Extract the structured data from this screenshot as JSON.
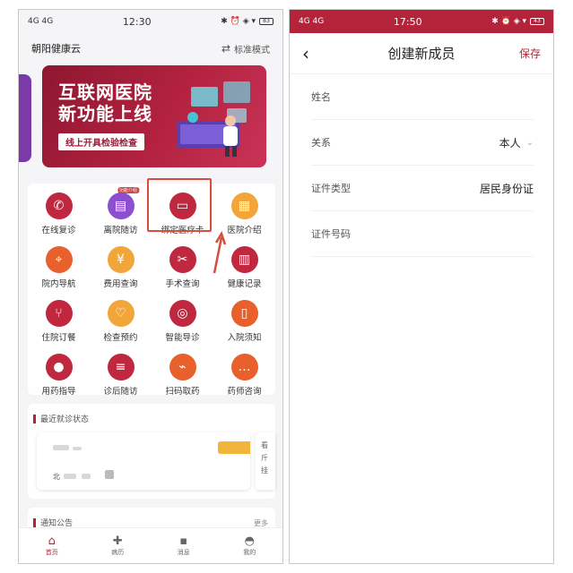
{
  "left": {
    "status": {
      "signal": "4G 4G",
      "time": "12:30",
      "icons": "✱ ⏰ ◈ ▾",
      "battery": "83"
    },
    "header": {
      "app_name": "朝阳健康云",
      "mode_icon": "switch-icon",
      "mode_label": "标准模式"
    },
    "banner": {
      "line1": "互联网医院",
      "line2": "新功能上线",
      "tag": "线上开具检验检查"
    },
    "grid": [
      {
        "label": "在线复诊",
        "icon": "phone-icon",
        "color": "red"
      },
      {
        "label": "离院随访",
        "icon": "document-icon",
        "color": "purple",
        "badge": "功能介绍"
      },
      {
        "label": "绑定医疗卡",
        "icon": "card-icon",
        "color": "red"
      },
      {
        "label": "医院介绍",
        "icon": "building-icon",
        "color": "yellow"
      },
      {
        "label": "院内导航",
        "icon": "location-icon",
        "color": "orange"
      },
      {
        "label": "费用查询",
        "icon": "receipt-icon",
        "color": "yellow"
      },
      {
        "label": "手术查询",
        "icon": "scissors-icon",
        "color": "red"
      },
      {
        "label": "健康记录",
        "icon": "record-icon",
        "color": "red"
      },
      {
        "label": "住院订餐",
        "icon": "utensils-icon",
        "color": "red"
      },
      {
        "label": "检查预约",
        "icon": "checkup-icon",
        "color": "yellow"
      },
      {
        "label": "智能导诊",
        "icon": "target-icon",
        "color": "red"
      },
      {
        "label": "入院须知",
        "icon": "book-icon",
        "color": "orange"
      },
      {
        "label": "用药指导",
        "icon": "pill-icon",
        "color": "red"
      },
      {
        "label": "诊后随访",
        "icon": "list-icon",
        "color": "red"
      },
      {
        "label": "扫码取药",
        "icon": "scan-icon",
        "color": "orange"
      },
      {
        "label": "药师咨询",
        "icon": "chat-icon",
        "color": "orange"
      }
    ],
    "recent": {
      "title": "最近就诊状态",
      "name_prefix": "北",
      "peek_text": "看\n斤\n挂"
    },
    "notice": {
      "title": "通知公告",
      "more": "更多"
    },
    "tabs": [
      {
        "label": "首页",
        "icon": "home-icon",
        "active": true
      },
      {
        "label": "病历",
        "icon": "medical-record-icon",
        "active": false
      },
      {
        "label": "消息",
        "icon": "message-icon",
        "active": false
      },
      {
        "label": "我的",
        "icon": "user-icon",
        "active": false
      }
    ]
  },
  "right": {
    "status": {
      "signal": "4G 4G",
      "time": "17:50",
      "icons": "✱ ⏰ ◈ ▾",
      "battery": "43"
    },
    "nav": {
      "back": "‹",
      "title": "创建新成员",
      "save": "保存"
    },
    "fields": [
      {
        "label": "姓名",
        "value": "",
        "chevron": false
      },
      {
        "label": "关系",
        "value": "本人",
        "chevron": true
      },
      {
        "label": "证件类型",
        "value": "居民身份证",
        "chevron": false
      },
      {
        "label": "证件号码",
        "value": "",
        "chevron": false
      }
    ]
  },
  "colors": {
    "brand": "#b3243a",
    "highlight": "#d84c3e"
  }
}
